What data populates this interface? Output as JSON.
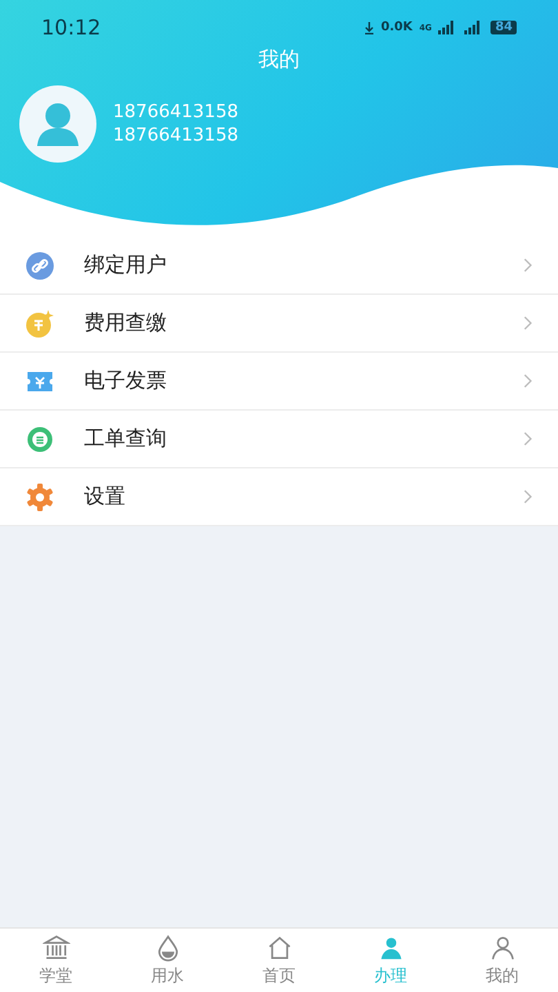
{
  "status_bar": {
    "time": "10:12",
    "network_speed": "0.0K",
    "network_type": "4G",
    "battery": "84"
  },
  "header": {
    "title": "我的",
    "user_name": "18766413158",
    "user_phone": "18766413158"
  },
  "menu": [
    {
      "label": "绑定用户",
      "kind": "link"
    },
    {
      "label": "费用查缴",
      "kind": "coin"
    },
    {
      "label": "电子发票",
      "kind": "ticket"
    },
    {
      "label": "工单查询",
      "kind": "order"
    },
    {
      "label": "设置",
      "kind": "gear"
    }
  ],
  "tab_bar": [
    {
      "label": "学堂",
      "kind": "school",
      "selected": false
    },
    {
      "label": "用水",
      "kind": "water",
      "selected": false
    },
    {
      "label": "首页",
      "kind": "home",
      "selected": false
    },
    {
      "label": "办理",
      "kind": "handle",
      "selected": true
    },
    {
      "label": "我的",
      "kind": "user",
      "selected": false
    }
  ]
}
